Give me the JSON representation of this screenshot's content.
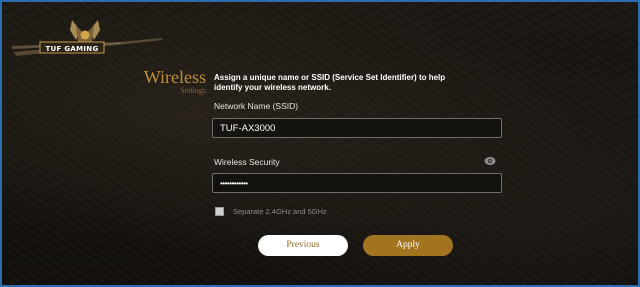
{
  "brand": {
    "logo_text": "TUF GAMING"
  },
  "wizard": {
    "title": "Wireless",
    "subtitle": "Settings",
    "intro_line1": "Assign a unique name or SSID (Service Set Identifier) to help",
    "intro_line2": "identify your wireless network."
  },
  "form": {
    "ssid_label": "Network Name (SSID)",
    "ssid_value": "TUF-AX3000",
    "security_label": "Wireless Security",
    "security_value": "••••••••••••",
    "separate_bands_label": "Separate 2.4GHz and 5GHz",
    "separate_bands_checked": false
  },
  "actions": {
    "previous_label": "Previous",
    "apply_label": "Apply"
  },
  "colors": {
    "accent_gold": "#a3741f",
    "frame_blue": "#2a6db0"
  },
  "icons": {
    "password_toggle": "eye-icon",
    "logo": "tuf-gaming-logo"
  }
}
